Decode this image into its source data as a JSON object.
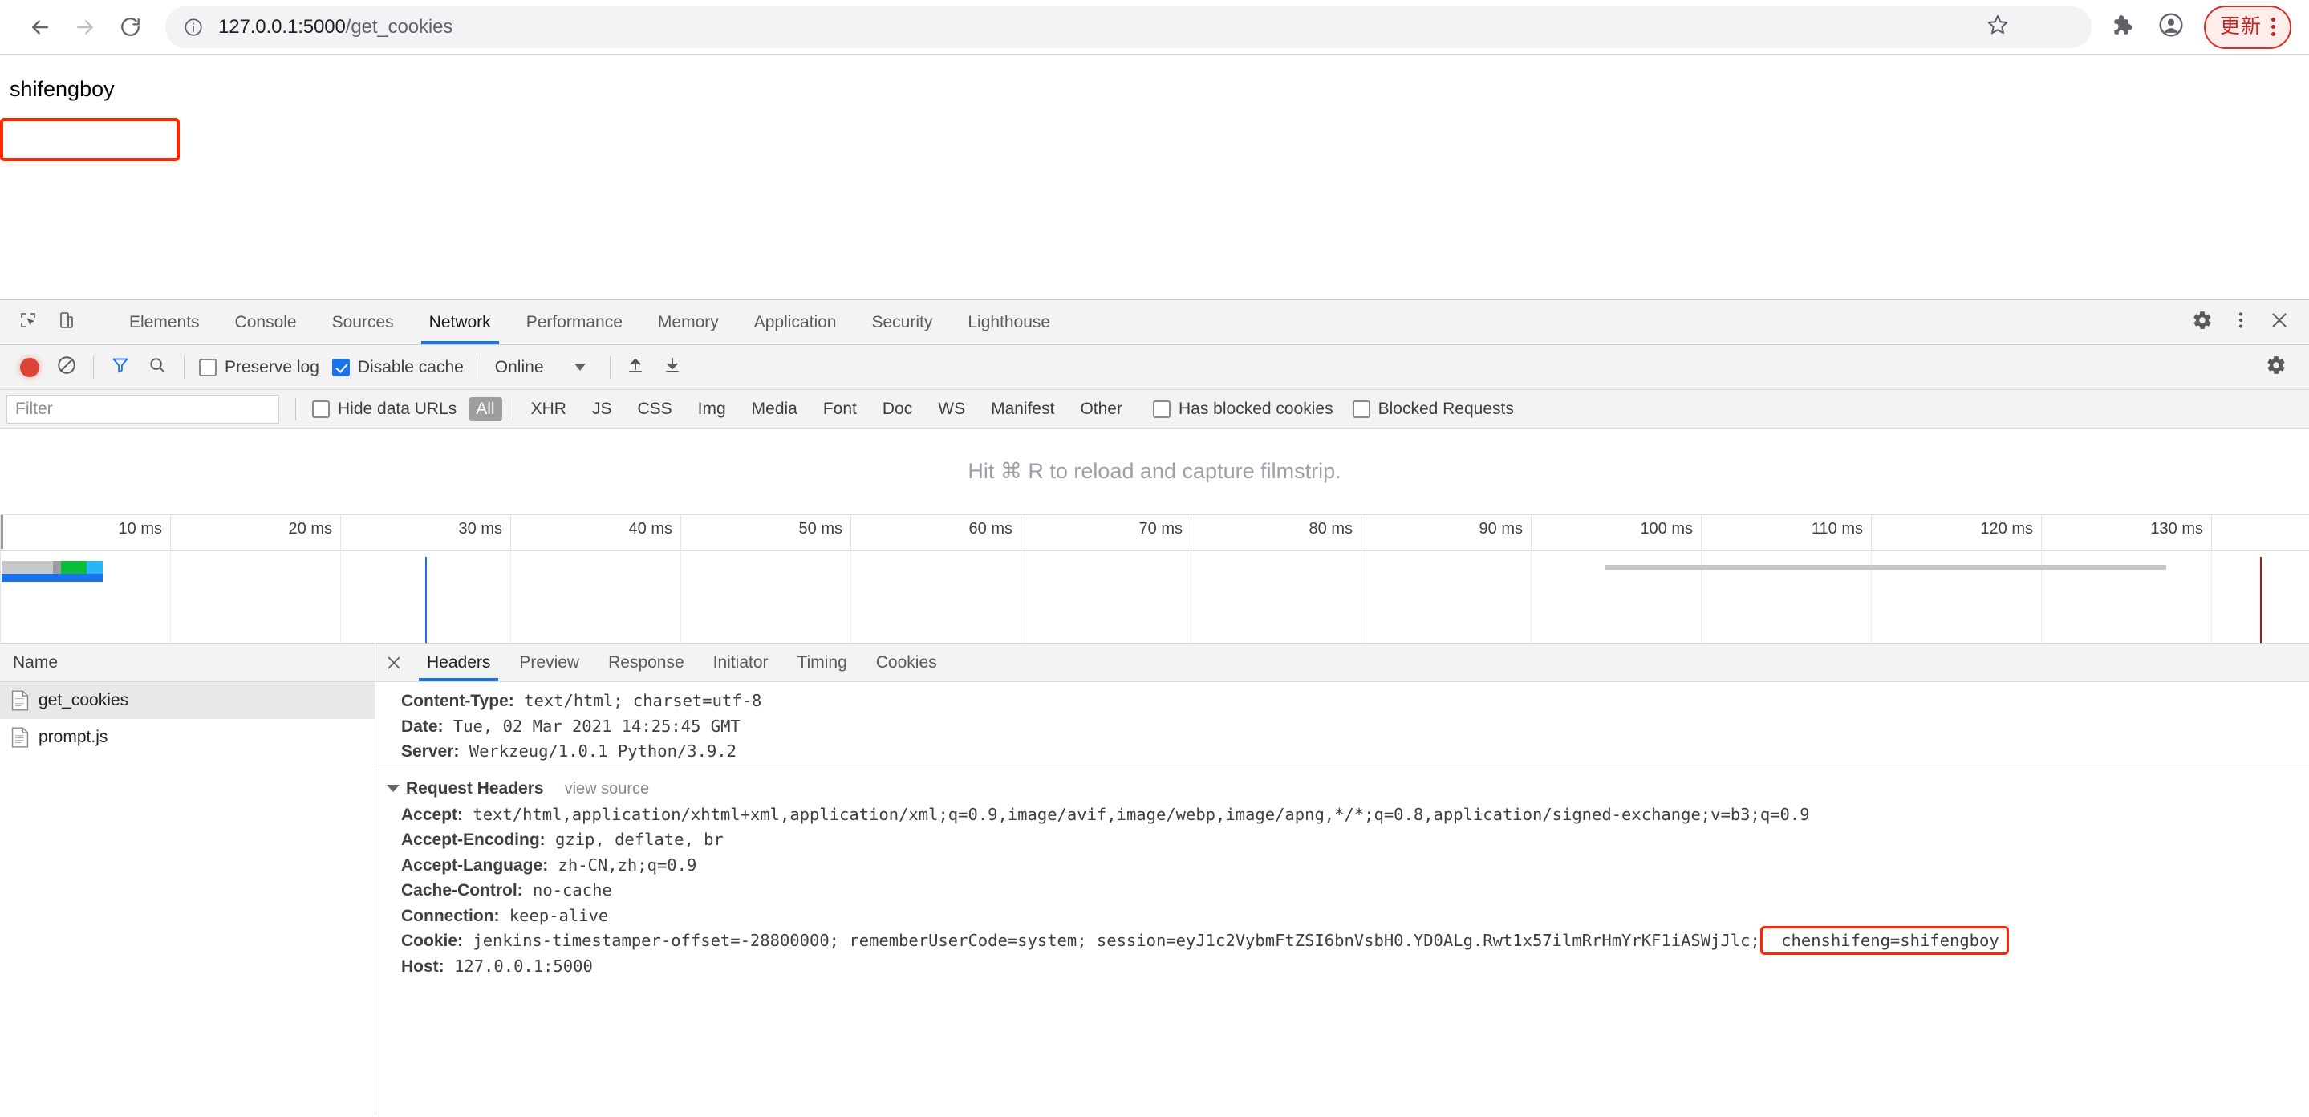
{
  "browser": {
    "back_icon": "arrow-left-icon",
    "forward_icon": "arrow-right-icon",
    "reload_icon": "reload-icon",
    "info_icon": "info-circle-icon",
    "url_host": "127.0.0.1:5000",
    "url_path": "/get_cookies",
    "star_icon": "bookmark-star-icon",
    "extensions_icon": "puzzle-piece-icon",
    "profile_icon": "account-avatar-icon",
    "update_label": "更新",
    "menu_icon": "three-dots-vertical-icon",
    "update_border_color": "#d93025"
  },
  "page": {
    "body_text": "shifengboy",
    "annotation_color": "#ff2600"
  },
  "devtools": {
    "inspect_icon": "inspect-element-icon",
    "device_icon": "device-toolbar-icon",
    "tabs": [
      {
        "label": "Elements",
        "active": false
      },
      {
        "label": "Console",
        "active": false
      },
      {
        "label": "Sources",
        "active": false
      },
      {
        "label": "Network",
        "active": true
      },
      {
        "label": "Performance",
        "active": false
      },
      {
        "label": "Memory",
        "active": false
      },
      {
        "label": "Application",
        "active": false
      },
      {
        "label": "Security",
        "active": false
      },
      {
        "label": "Lighthouse",
        "active": false
      }
    ],
    "settings_icon": "gear-icon",
    "more_icon": "three-dots-vertical-icon",
    "close_icon": "close-x-icon"
  },
  "network_toolbar": {
    "record_icon": "record-circle-icon",
    "clear_icon": "clear-no-entry-icon",
    "filter_icon": "funnel-filter-icon",
    "search_icon": "magnifier-search-icon",
    "preserve_log_label": "Preserve log",
    "preserve_log_checked": false,
    "disable_cache_label": "Disable cache",
    "disable_cache_checked": true,
    "throttle_value": "Online",
    "import_icon": "upload-arrow-icon",
    "export_icon": "download-arrow-icon",
    "settings_icon": "gear-icon",
    "accent_color": "#1a73e8"
  },
  "filter_bar": {
    "filter_placeholder": "Filter",
    "filter_value": "",
    "hide_data_urls_label": "Hide data URLs",
    "hide_data_urls_checked": false,
    "types": [
      "All",
      "XHR",
      "JS",
      "CSS",
      "Img",
      "Media",
      "Font",
      "Doc",
      "WS",
      "Manifest",
      "Other"
    ],
    "active_type": "All",
    "has_blocked_cookies_label": "Has blocked cookies",
    "has_blocked_cookies_checked": false,
    "blocked_requests_label": "Blocked Requests",
    "blocked_requests_checked": false
  },
  "filmstrip": {
    "hint": "Hit ⌘ R to reload and capture filmstrip."
  },
  "overview": {
    "ticks": [
      "10 ms",
      "20 ms",
      "30 ms",
      "40 ms",
      "50 ms",
      "60 ms",
      "70 ms",
      "80 ms",
      "90 ms",
      "100 ms",
      "110 ms",
      "120 ms",
      "130 ms"
    ],
    "dom_content_loaded_color": "#1a73e8",
    "load_event_color": "#b31412"
  },
  "request_list": {
    "column_header": "Name",
    "rows": [
      {
        "name": "get_cookies",
        "selected": true,
        "icon": "document-file-icon"
      },
      {
        "name": "prompt.js",
        "selected": false,
        "icon": "document-file-icon"
      }
    ]
  },
  "detail_panel": {
    "close_icon": "close-x-icon",
    "tabs": [
      {
        "label": "Headers",
        "active": true
      },
      {
        "label": "Preview",
        "active": false
      },
      {
        "label": "Response",
        "active": false
      },
      {
        "label": "Initiator",
        "active": false
      },
      {
        "label": "Timing",
        "active": false
      },
      {
        "label": "Cookies",
        "active": false
      }
    ],
    "response_headers": [
      {
        "key": "Content-Type:",
        "value": "text/html; charset=utf-8"
      },
      {
        "key": "Date:",
        "value": "Tue, 02 Mar 2021 14:25:45 GMT"
      },
      {
        "key": "Server:",
        "value": "Werkzeug/1.0.1 Python/3.9.2"
      }
    ],
    "request_headers_title": "Request Headers",
    "view_source_label": "view source",
    "request_headers": [
      {
        "key": "Accept:",
        "value": "text/html,application/xhtml+xml,application/xml;q=0.9,image/avif,image/webp,image/apng,*/*;q=0.8,application/signed-exchange;v=b3;q=0.9"
      },
      {
        "key": "Accept-Encoding:",
        "value": "gzip, deflate, br"
      },
      {
        "key": "Accept-Language:",
        "value": "zh-CN,zh;q=0.9"
      },
      {
        "key": "Cache-Control:",
        "value": "no-cache"
      },
      {
        "key": "Connection:",
        "value": "keep-alive"
      },
      {
        "key": "Cookie:",
        "value": "jenkins-timestamper-offset=-28800000; rememberUserCode=system; session=eyJ1c2VybmFtZSI6bnVsbH0.YD0ALg.Rwt1x57ilmRrHmYrKF1iASWjJlc;"
      },
      {
        "key": "Host:",
        "value": "127.0.0.1:5000"
      }
    ],
    "highlighted_cookie": "chenshifeng=shifengboy"
  }
}
